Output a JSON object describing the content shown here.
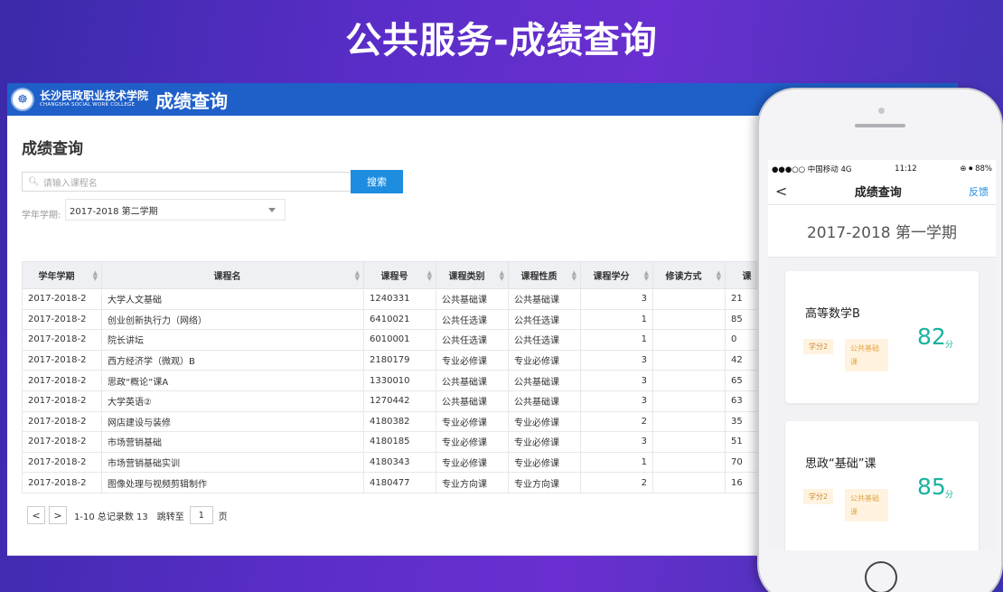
{
  "slide": {
    "title": "公共服务-成绩查询"
  },
  "header": {
    "school_cn": "长沙民政职业技术学院",
    "school_en": "CHANGSHA SOCIAL WORK COLLEGE",
    "app_name": "成绩查询"
  },
  "page": {
    "title": "成绩查询"
  },
  "search": {
    "placeholder": "请输入课程名",
    "button": "搜索"
  },
  "term_filter": {
    "label": "学年学期:",
    "value": "2017-2018 第二学期"
  },
  "table": {
    "columns": [
      "学年学期",
      "课程名",
      "课程号",
      "课程类别",
      "课程性质",
      "课程学分",
      "修读方式",
      "课"
    ],
    "rows": [
      [
        "2017-2018-2",
        "大学人文基础",
        "1240331",
        "公共基础课",
        "公共基础课",
        "3",
        "",
        "21"
      ],
      [
        "2017-2018-2",
        "创业创新执行力（网络）",
        "6410021",
        "公共任选课",
        "公共任选课",
        "1",
        "",
        "85"
      ],
      [
        "2017-2018-2",
        "院长讲坛",
        "6010001",
        "公共任选课",
        "公共任选课",
        "1",
        "",
        "0"
      ],
      [
        "2017-2018-2",
        "西方经济学（微观）B",
        "2180179",
        "专业必修课",
        "专业必修课",
        "3",
        "",
        "42"
      ],
      [
        "2017-2018-2",
        "思政“概论”课A",
        "1330010",
        "公共基础课",
        "公共基础课",
        "3",
        "",
        "65"
      ],
      [
        "2017-2018-2",
        "大学英语②",
        "1270442",
        "公共基础课",
        "公共基础课",
        "3",
        "",
        "63"
      ],
      [
        "2017-2018-2",
        "网店建设与装修",
        "4180382",
        "专业必修课",
        "专业必修课",
        "2",
        "",
        "35"
      ],
      [
        "2017-2018-2",
        "市场营销基础",
        "4180185",
        "专业必修课",
        "专业必修课",
        "3",
        "",
        "51"
      ],
      [
        "2017-2018-2",
        "市场营销基础实训",
        "4180343",
        "专业必修课",
        "专业必修课",
        "1",
        "",
        "70"
      ],
      [
        "2017-2018-2",
        "图像处理与视频剪辑制作",
        "4180477",
        "专业方向课",
        "专业方向课",
        "2",
        "",
        "16"
      ]
    ]
  },
  "pager": {
    "prev": "<",
    "next": ">",
    "summary": "1-10 总记录数 13",
    "jump_label": "跳转至",
    "jump_value": "1",
    "page_unit": "页"
  },
  "phone": {
    "status": {
      "carrier": "●●●○○ 中国移动  4G",
      "time": "11:12",
      "battery": "⊕ ⏺ 88%"
    },
    "nav": {
      "back": "<",
      "title": "成绩查询",
      "feedback": "反馈"
    },
    "term": "2017-2018 第一学期",
    "cards": [
      {
        "course": "高等数学B",
        "credit": "学分2",
        "type": "公共基础课",
        "score": "82",
        "unit": "分"
      },
      {
        "course": "思政“基础”课",
        "credit": "学分2",
        "type": "公共基础课",
        "score": "85",
        "unit": "分"
      }
    ]
  },
  "colors": {
    "header_blue": "#1f5fc8",
    "button_blue": "#1e8de0",
    "score_teal": "#19b3a0",
    "tag_orange": "#e4a642"
  }
}
